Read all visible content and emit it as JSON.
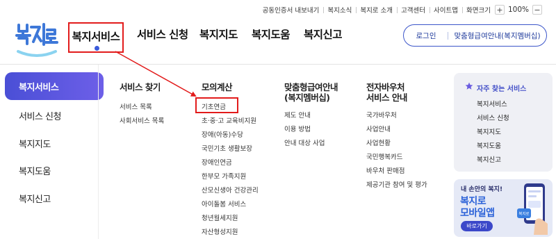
{
  "utility_bar": {
    "links": [
      "공동인증서 내보내기",
      "복지소식",
      "복지로 소개",
      "고객센터",
      "사이트맵"
    ],
    "zoom_label": "화면크기",
    "zoom_in": "+",
    "zoom_value": "100%",
    "zoom_out": "−"
  },
  "logo": {
    "text": "복지로"
  },
  "nav": {
    "items": [
      "복지서비스",
      "서비스 신청",
      "복지지도",
      "복지도움",
      "복지신고"
    ],
    "active_index": 0
  },
  "header_buttons": {
    "login": "로그인",
    "customized": "맞춤형급여안내(복지멤버십)"
  },
  "side_menu": {
    "items": [
      "복지서비스",
      "서비스 신청",
      "복지지도",
      "복지도움",
      "복지신고"
    ],
    "active_index": 0
  },
  "columns": [
    {
      "title": "서비스 찾기",
      "links": [
        "서비스 목록",
        "사회서비스 목록"
      ]
    },
    {
      "title": "모의계산",
      "links": [
        "기초연금",
        "초·중·고 교육비지원",
        "장애(아동)수당",
        "국민기초 생활보장",
        "장애인연금",
        "한부모 가족지원",
        "산모신생아 건강관리",
        "아이돌봄 서비스",
        "청년월세지원",
        "자산형성지원"
      ]
    },
    {
      "title_lines": [
        "맞춤형급여안내",
        "(복지멤버십)"
      ],
      "links": [
        "제도 안내",
        "이용 방법",
        "안내 대상 사업"
      ]
    },
    {
      "title_lines": [
        "전자바우처",
        "서비스 안내"
      ],
      "links": [
        "국가바우처",
        "사업안내",
        "사업현황",
        "국민행복카드",
        "바우처 판매점",
        "제공기관 참여 및 평가"
      ]
    }
  ],
  "favorites": {
    "title": "자주 찾는 서비스",
    "icon": "star-icon",
    "items": [
      "복지서비스",
      "서비스 신청",
      "복지지도",
      "복지도움",
      "복지신고"
    ]
  },
  "banner": {
    "small": "내 손안의 복지!",
    "line1": "복지로",
    "line2": "모바일앱",
    "button": "바로가기",
    "phone_text": "복지로"
  },
  "colors": {
    "accent": "#3b55c9",
    "side_active_start": "#4a4fd6",
    "side_active_end": "#6d5fe8",
    "highlight": "#e21b1b",
    "logo_blue": "#3e78d8",
    "banner_blue": "#2b62d8"
  }
}
